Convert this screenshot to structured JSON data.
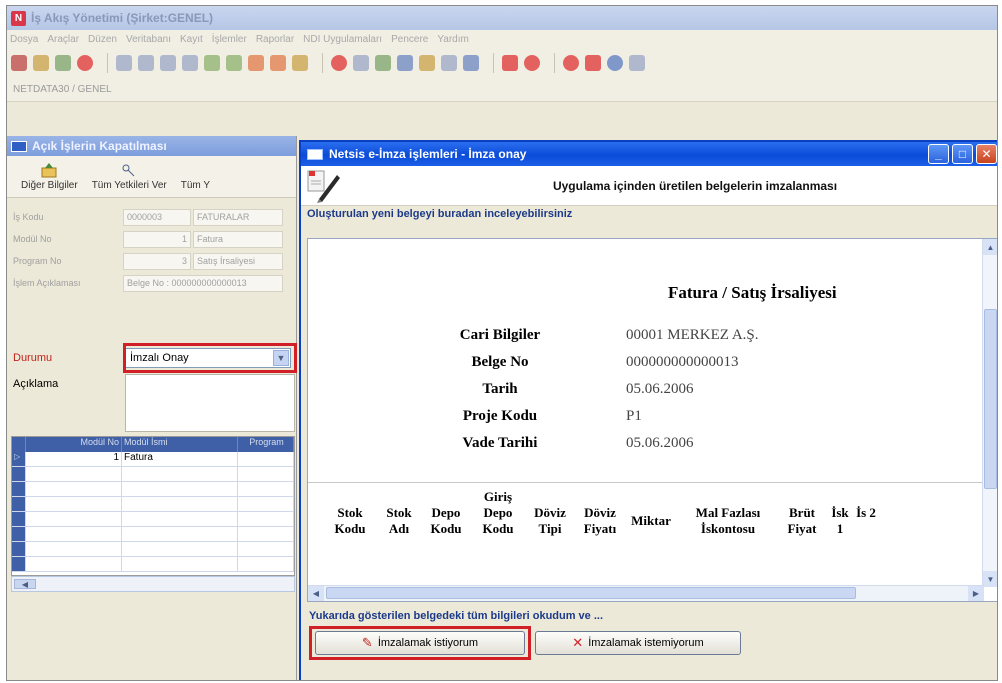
{
  "app": {
    "title": "İş Akış Yönetimi (Şirket:GENEL)",
    "menu": [
      "Dosya",
      "Araçlar",
      "Düzen",
      "Veritabanı",
      "Kayıt",
      "İşlemler",
      "Raporlar",
      "NDI Uygulamaları",
      "Pencere",
      "Yardım"
    ],
    "address": "NETDATA30 / GENEL"
  },
  "left_window": {
    "title": "Açık İşlerin Kapatılması",
    "tools": [
      "Diğer Bilgiler",
      "Tüm Yetkileri Ver",
      "Tüm Y"
    ],
    "fields": [
      {
        "label": "İş Kodu",
        "value": "0000003",
        "extra": "FATURALAR"
      },
      {
        "label": "Modül No",
        "value": "1",
        "extra": "Fatura"
      },
      {
        "label": "Program No",
        "value": "3",
        "extra": "Satış İrsaliyesi"
      },
      {
        "label": "İşlem Açıklaması",
        "value": "Belge No : 000000000000013"
      }
    ],
    "durum_label": "Durumu",
    "durum_value": "İmzalı Onay",
    "aciklama_label": "Açıklama",
    "grid_headers": [
      "Modül No",
      "Modül İsmi",
      "Program"
    ],
    "grid_rows": [
      {
        "no": "1",
        "name": "Fatura"
      }
    ]
  },
  "dialog": {
    "title": "Netsis e-İmza işlemleri - İmza onay",
    "header_text": "Uygulama içinden üretilen belgelerin imzalanması",
    "sub_header": "Oluşturulan yeni belgeyi buradan inceleyebilirsiniz",
    "doc_title": "Fatura / Satış İrsaliyesi",
    "info": [
      {
        "label": "Cari Bilgiler",
        "value": "00001 MERKEZ A.Ş."
      },
      {
        "label": "Belge No",
        "value": "000000000000013"
      },
      {
        "label": "Tarih",
        "value": "05.06.2006"
      },
      {
        "label": "Proje Kodu",
        "value": "P1"
      },
      {
        "label": "Vade Tarihi",
        "value": "05.06.2006"
      }
    ],
    "columns": [
      "Stok Kodu",
      "Stok Adı",
      "Depo Kodu",
      "Giriş Depo Kodu",
      "Döviz Tipi",
      "Döviz Fiyatı",
      "Miktar",
      "Mal Fazlası İskontosu",
      "Brüt Fiyat",
      "İsk 1",
      "İs 2"
    ],
    "confirm_text": "Yukarıda gösterilen belgedeki tüm bilgileri okudum ve ...",
    "sign_button": "İmzalamak istiyorum",
    "nosign_button": "İmzalamak istemiyorum"
  },
  "colors": {
    "dialog_title": "#0b4bd8",
    "highlight": "#d11f28",
    "header_blue": "#1d3a8a"
  }
}
